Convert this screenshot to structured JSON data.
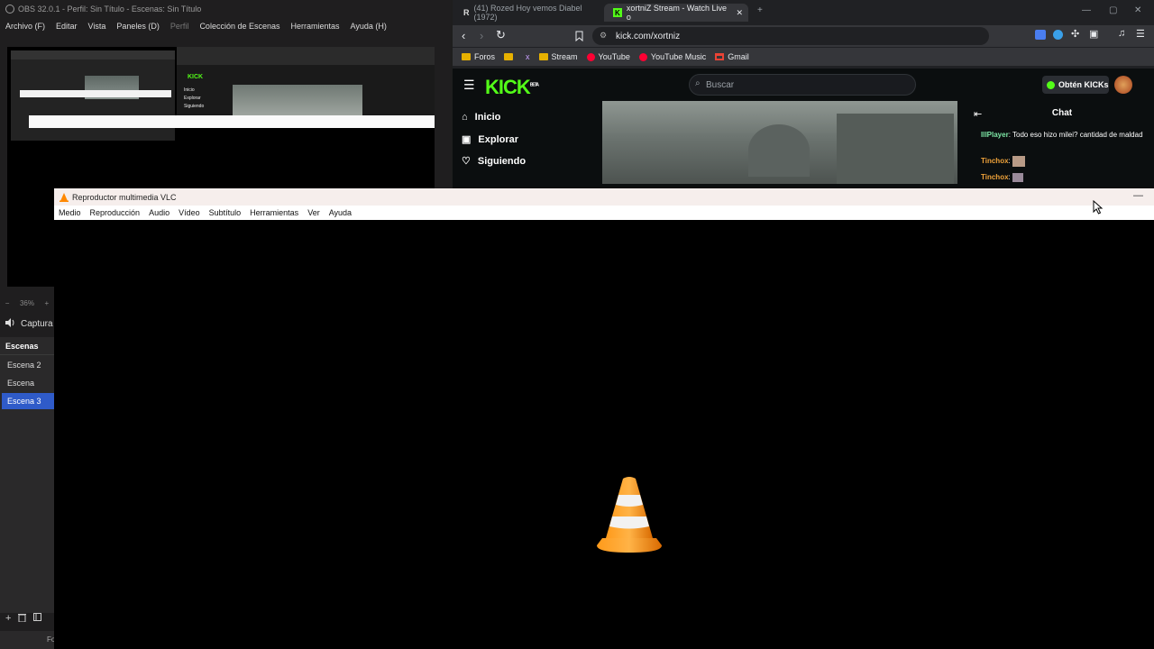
{
  "obs": {
    "title": "OBS 32.0.1 - Perfil: Sin Título - Escenas: Sin Título",
    "menu": [
      "Archivo (F)",
      "Editar",
      "Vista",
      "Paneles (D)",
      "Perfil",
      "Colección de Escenas",
      "Herramientas",
      "Ayuda (H)"
    ],
    "zoom": "36%",
    "zoom_minus": "−",
    "zoom_plus": "+",
    "source_label": "Captura",
    "scenes_header": "Escenas",
    "scenes": [
      "Escena 2",
      "Escena",
      "Escena 3"
    ],
    "active_scene": "Escena 3",
    "bottom_bar_text": "Fo"
  },
  "browser": {
    "tabs": [
      {
        "label": "(41) Rozed Hoy vemos Diabel (1972)",
        "icon": "R"
      },
      {
        "label": "xortniZ Stream - Watch Live o",
        "icon": "K"
      }
    ],
    "new_tab": "+",
    "url": "kick.com/xortniz",
    "bookmarks": [
      {
        "label": "Foros",
        "type": "folder"
      },
      {
        "label": "",
        "type": "folder"
      },
      {
        "label": "x",
        "type": "x"
      },
      {
        "label": "Stream",
        "type": "folder"
      },
      {
        "label": "YouTube",
        "type": "youtube"
      },
      {
        "label": "YouTube Music",
        "type": "youtube"
      },
      {
        "label": "Gmail",
        "type": "gmail"
      }
    ]
  },
  "kick": {
    "logo": "KICK",
    "logo_badge": "BETA",
    "search_placeholder": "Buscar",
    "kicks_button": "Obtén KICKs",
    "nav": [
      "Inicio",
      "Explorar",
      "Siguiendo"
    ],
    "chat_title": "Chat",
    "chat_messages": [
      {
        "user": "IllPlayer",
        "text": ": Todo eso hizo milei? cantidad de maldad"
      },
      {
        "user": "Tinchox",
        "text": ":"
      },
      {
        "user": "Tinchox",
        "text": ":"
      }
    ]
  },
  "vlc": {
    "title": "Reproductor multimedia VLC",
    "menu": [
      "Medio",
      "Reproducción",
      "Audio",
      "Vídeo",
      "Subtítulo",
      "Herramientas",
      "Ver",
      "Ayuda"
    ],
    "minimize": "—"
  },
  "colors": {
    "kick_green": "#53fc18",
    "vlc_orange": "#ff8800",
    "obs_active_scene": "#2f5bc9"
  }
}
